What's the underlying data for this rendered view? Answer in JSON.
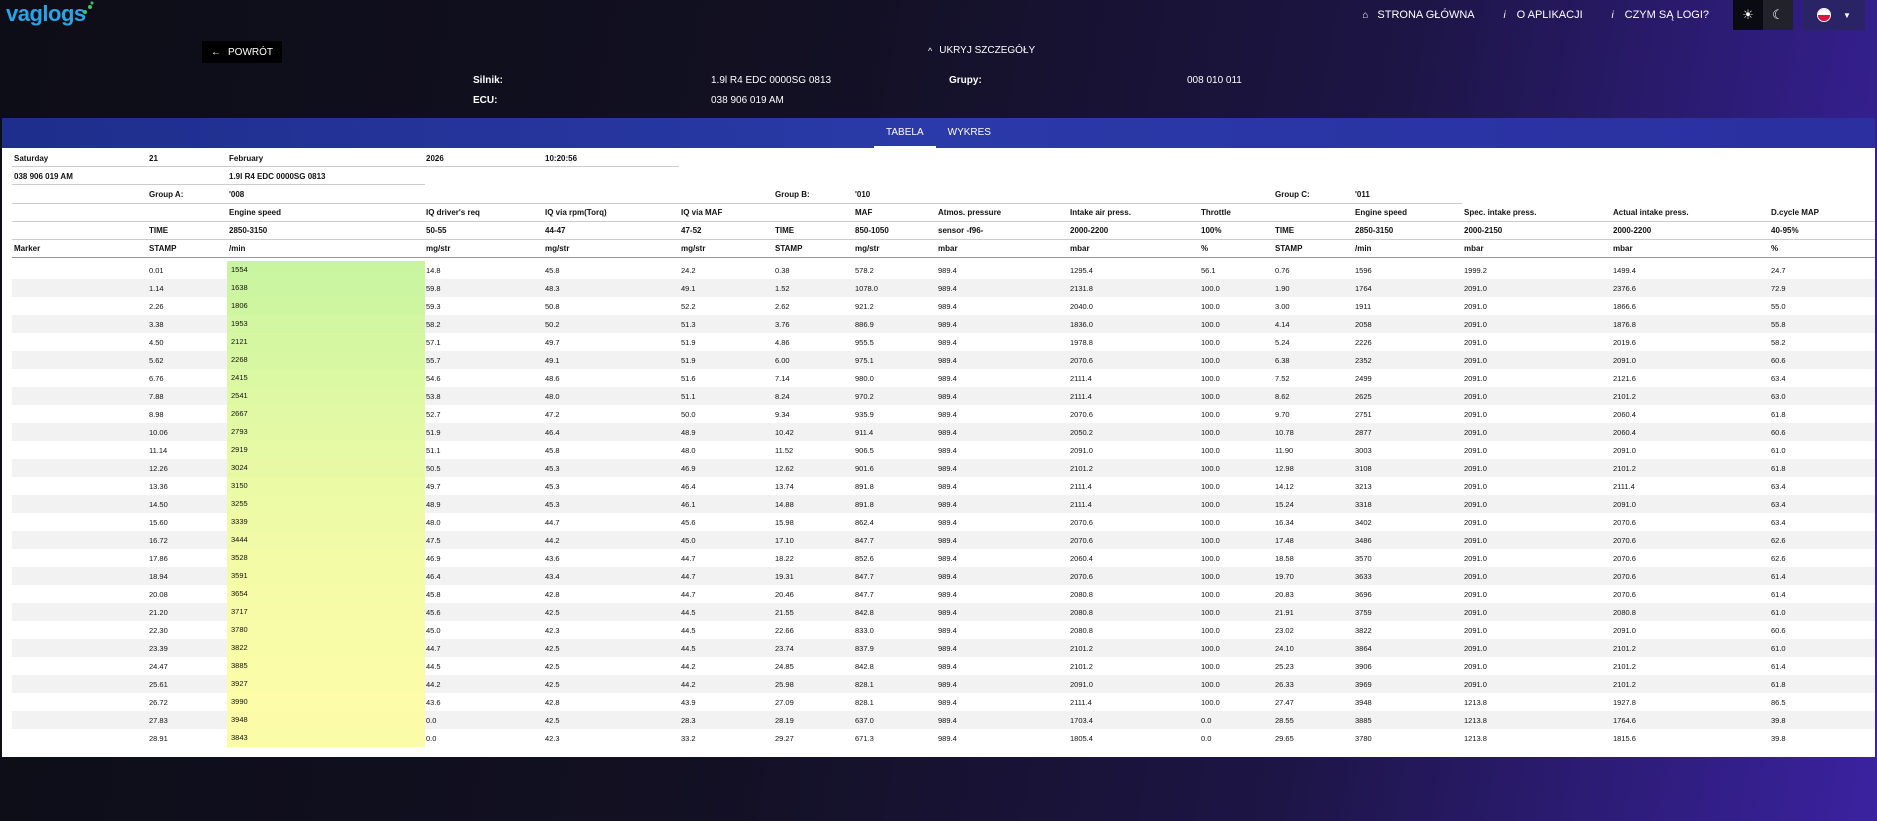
{
  "app": {
    "logo": "vaglogs"
  },
  "nav": {
    "home": "STRONA GŁÓWNA",
    "about": "O APLIKACJI",
    "what_logs": "CZYM SĄ LOGI?",
    "icons": {
      "home": "home-icon",
      "about": "info-icon",
      "what_logs": "info-icon",
      "light": "sun-icon",
      "dark": "moon-icon"
    }
  },
  "back_label": "POWRÓT",
  "hide_details_label": "UKRYJ SZCZEGÓŁY",
  "details": {
    "engine_label": "Silnik:",
    "engine_value": "1.9l R4 EDC 0000SG 0813",
    "groups_label": "Grupy:",
    "groups_value": "008 010 011",
    "ecu_label": "ECU:",
    "ecu_value": "038 906 019 AM"
  },
  "tabs": {
    "table": "TABELA",
    "chart": "WYKRES"
  },
  "log_header": {
    "day": "Saturday",
    "date": "21",
    "month": "February",
    "year": "2026",
    "time": "10:20:56",
    "ecu": "038 906 019 AM",
    "engine": "1.9l R4 EDC 0000SG 0813"
  },
  "groups": {
    "a_label": "Group A:",
    "a_value": "'008",
    "b_label": "Group B:",
    "b_value": "'010",
    "c_label": "Group C:",
    "c_value": "'011"
  },
  "columns": [
    {
      "name": "",
      "spec": "",
      "unit": "Marker"
    },
    {
      "name": "",
      "spec": "TIME",
      "unit": "STAMP"
    },
    {
      "name": "Engine speed",
      "spec": "2850-3150",
      "unit": "/min"
    },
    {
      "name": "IQ driver's req",
      "spec": "50-55",
      "unit": "mg/str"
    },
    {
      "name": "IQ via rpm(Torq)",
      "spec": "44-47",
      "unit": "mg/str"
    },
    {
      "name": "IQ via MAF",
      "spec": "47-52",
      "unit": "mg/str"
    },
    {
      "name": "",
      "spec": "TIME",
      "unit": "STAMP"
    },
    {
      "name": "MAF",
      "spec": "850-1050",
      "unit": "mg/str"
    },
    {
      "name": "Atmos. pressure",
      "spec": "sensor -f96-",
      "unit": "mbar"
    },
    {
      "name": "Intake air press.",
      "spec": "2000-2200",
      "unit": "mbar"
    },
    {
      "name": "Throttle",
      "spec": "100%",
      "unit": "%"
    },
    {
      "name": "",
      "spec": "TIME",
      "unit": "STAMP"
    },
    {
      "name": "Engine speed",
      "spec": "2850-3150",
      "unit": "/min"
    },
    {
      "name": "Spec. intake press.",
      "spec": "2000-2150",
      "unit": "mbar"
    },
    {
      "name": "Actual intake press.",
      "spec": "2000-2200",
      "unit": "mbar"
    },
    {
      "name": "D.cycle MAP",
      "spec": "40-95%",
      "unit": "%"
    }
  ],
  "rows": [
    [
      "",
      "0.01",
      "1554",
      "14.8",
      "45.8",
      "24.2",
      "0.38",
      "578.2",
      "989.4",
      "1295.4",
      "56.1",
      "0.76",
      "1596",
      "1999.2",
      "1499.4",
      "24.7"
    ],
    [
      "",
      "1.14",
      "1638",
      "59.8",
      "48.3",
      "49.1",
      "1.52",
      "1078.0",
      "989.4",
      "2131.8",
      "100.0",
      "1.90",
      "1764",
      "2091.0",
      "2376.6",
      "72.9"
    ],
    [
      "",
      "2.26",
      "1806",
      "59.3",
      "50.8",
      "52.2",
      "2.62",
      "921.2",
      "989.4",
      "2040.0",
      "100.0",
      "3.00",
      "1911",
      "2091.0",
      "1866.6",
      "55.0"
    ],
    [
      "",
      "3.38",
      "1953",
      "58.2",
      "50.2",
      "51.3",
      "3.76",
      "886.9",
      "989.4",
      "1836.0",
      "100.0",
      "4.14",
      "2058",
      "2091.0",
      "1876.8",
      "55.8"
    ],
    [
      "",
      "4.50",
      "2121",
      "57.1",
      "49.7",
      "51.9",
      "4.86",
      "955.5",
      "989.4",
      "1978.8",
      "100.0",
      "5.24",
      "2226",
      "2091.0",
      "2019.6",
      "58.2"
    ],
    [
      "",
      "5.62",
      "2268",
      "55.7",
      "49.1",
      "51.9",
      "6.00",
      "975.1",
      "989.4",
      "2070.6",
      "100.0",
      "6.38",
      "2352",
      "2091.0",
      "2091.0",
      "60.6"
    ],
    [
      "",
      "6.76",
      "2415",
      "54.6",
      "48.6",
      "51.6",
      "7.14",
      "980.0",
      "989.4",
      "2111.4",
      "100.0",
      "7.52",
      "2499",
      "2091.0",
      "2121.6",
      "63.4"
    ],
    [
      "",
      "7.88",
      "2541",
      "53.8",
      "48.0",
      "51.1",
      "8.24",
      "970.2",
      "989.4",
      "2111.4",
      "100.0",
      "8.62",
      "2625",
      "2091.0",
      "2101.2",
      "63.0"
    ],
    [
      "",
      "8.98",
      "2667",
      "52.7",
      "47.2",
      "50.0",
      "9.34",
      "935.9",
      "989.4",
      "2070.6",
      "100.0",
      "9.70",
      "2751",
      "2091.0",
      "2060.4",
      "61.8"
    ],
    [
      "",
      "10.06",
      "2793",
      "51.9",
      "46.4",
      "48.9",
      "10.42",
      "911.4",
      "989.4",
      "2050.2",
      "100.0",
      "10.78",
      "2877",
      "2091.0",
      "2060.4",
      "60.6"
    ],
    [
      "",
      "11.14",
      "2919",
      "51.1",
      "45.8",
      "48.0",
      "11.52",
      "906.5",
      "989.4",
      "2091.0",
      "100.0",
      "11.90",
      "3003",
      "2091.0",
      "2091.0",
      "61.0"
    ],
    [
      "",
      "12.26",
      "3024",
      "50.5",
      "45.3",
      "46.9",
      "12.62",
      "901.6",
      "989.4",
      "2101.2",
      "100.0",
      "12.98",
      "3108",
      "2091.0",
      "2101.2",
      "61.8"
    ],
    [
      "",
      "13.36",
      "3150",
      "49.7",
      "45.3",
      "46.4",
      "13.74",
      "891.8",
      "989.4",
      "2111.4",
      "100.0",
      "14.12",
      "3213",
      "2091.0",
      "2111.4",
      "63.4"
    ],
    [
      "",
      "14.50",
      "3255",
      "48.9",
      "45.3",
      "46.1",
      "14.88",
      "891.8",
      "989.4",
      "2111.4",
      "100.0",
      "15.24",
      "3318",
      "2091.0",
      "2091.0",
      "63.4"
    ],
    [
      "",
      "15.60",
      "3339",
      "48.0",
      "44.7",
      "45.6",
      "15.98",
      "862.4",
      "989.4",
      "2070.6",
      "100.0",
      "16.34",
      "3402",
      "2091.0",
      "2070.6",
      "63.4"
    ],
    [
      "",
      "16.72",
      "3444",
      "47.5",
      "44.2",
      "45.0",
      "17.10",
      "847.7",
      "989.4",
      "2070.6",
      "100.0",
      "17.48",
      "3486",
      "2091.0",
      "2070.6",
      "62.6"
    ],
    [
      "",
      "17.86",
      "3528",
      "46.9",
      "43.6",
      "44.7",
      "18.22",
      "852.6",
      "989.4",
      "2060.4",
      "100.0",
      "18.58",
      "3570",
      "2091.0",
      "2070.6",
      "62.6"
    ],
    [
      "",
      "18.94",
      "3591",
      "46.4",
      "43.4",
      "44.7",
      "19.31",
      "847.7",
      "989.4",
      "2070.6",
      "100.0",
      "19.70",
      "3633",
      "2091.0",
      "2070.6",
      "61.4"
    ],
    [
      "",
      "20.08",
      "3654",
      "45.8",
      "42.8",
      "44.7",
      "20.46",
      "847.7",
      "989.4",
      "2080.8",
      "100.0",
      "20.83",
      "3696",
      "2091.0",
      "2070.6",
      "61.4"
    ],
    [
      "",
      "21.20",
      "3717",
      "45.6",
      "42.5",
      "44.5",
      "21.55",
      "842.8",
      "989.4",
      "2080.8",
      "100.0",
      "21.91",
      "3759",
      "2091.0",
      "2080.8",
      "61.0"
    ],
    [
      "",
      "22.30",
      "3780",
      "45.0",
      "42.3",
      "44.5",
      "22.66",
      "833.0",
      "989.4",
      "2080.8",
      "100.0",
      "23.02",
      "3822",
      "2091.0",
      "2091.0",
      "60.6"
    ],
    [
      "",
      "23.39",
      "3822",
      "44.7",
      "42.5",
      "44.5",
      "23.74",
      "837.9",
      "989.4",
      "2101.2",
      "100.0",
      "24.10",
      "3864",
      "2091.0",
      "2101.2",
      "61.0"
    ],
    [
      "",
      "24.47",
      "3885",
      "44.5",
      "42.5",
      "44.2",
      "24.85",
      "842.8",
      "989.4",
      "2101.2",
      "100.0",
      "25.23",
      "3906",
      "2091.0",
      "2101.2",
      "61.4"
    ],
    [
      "",
      "25.61",
      "3927",
      "44.2",
      "42.5",
      "44.2",
      "25.98",
      "828.1",
      "989.4",
      "2091.0",
      "100.0",
      "26.33",
      "3969",
      "2091.0",
      "2101.2",
      "61.8"
    ],
    [
      "",
      "26.72",
      "3990",
      "43.6",
      "42.8",
      "43.9",
      "27.09",
      "828.1",
      "989.4",
      "2111.4",
      "100.0",
      "27.47",
      "3948",
      "1213.8",
      "1927.8",
      "86.5"
    ],
    [
      "",
      "27.83",
      "3948",
      "0.0",
      "42.5",
      "28.3",
      "28.19",
      "637.0",
      "989.4",
      "1703.4",
      "0.0",
      "28.55",
      "3885",
      "1213.8",
      "1764.6",
      "39.8"
    ],
    [
      "",
      "28.91",
      "3843",
      "0.0",
      "42.3",
      "33.2",
      "29.27",
      "671.3",
      "989.4",
      "1805.4",
      "0.0",
      "29.65",
      "3780",
      "1213.8",
      "1815.6",
      "39.8"
    ]
  ],
  "colors": {
    "accent": "#29a3e6",
    "tab_bar": "#2a3aa8",
    "speed_low": "#c8f5a0",
    "speed_high": "#fdfca8"
  }
}
